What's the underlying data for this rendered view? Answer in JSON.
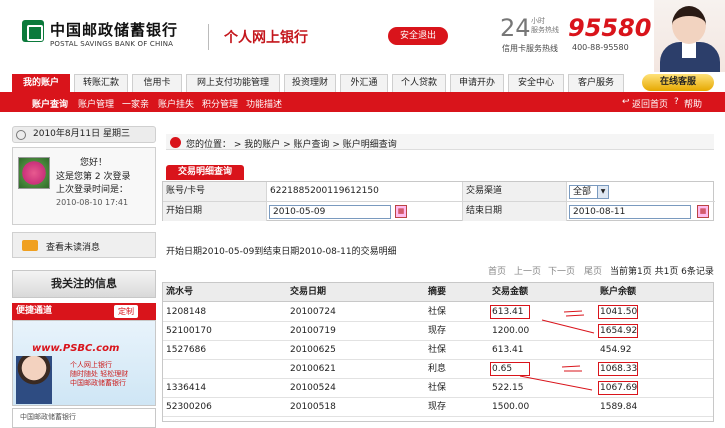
{
  "header": {
    "bank_cn": "中国邮政储蓄银行",
    "bank_en": "POSTAL SAVINGS BANK OF CHINA",
    "personal_bank": "个人网上银行",
    "logout_label": "安全退出",
    "hour24": "24",
    "service_small": "小时\n服务热线",
    "hotline": "95580",
    "card_hotline_label": "信用卡服务热线",
    "card_hotline": "400-88-95580"
  },
  "nav": {
    "tabs": [
      "我的账户",
      "转账汇款",
      "信用卡",
      "网上支付功能管理",
      "投资理财",
      "外汇通",
      "个人贷款",
      "申请开办",
      "安全中心",
      "客户服务"
    ],
    "online_service": "在线客服",
    "sub_items": [
      "账户查询",
      "账户管理",
      "一家亲",
      "账户挂失",
      "积分管理",
      "功能描述"
    ],
    "back_home": "返回首页",
    "help": "帮助"
  },
  "left": {
    "date": "2010年8月11日 星期三",
    "greeting": "您好！",
    "login_count_text": "这是您第 2 次登录",
    "last_login_label": "上次登录时间是：",
    "last_login_time": "2010-08-10 17:41",
    "unread_msgs": "查看未读消息",
    "focus_title": "我关注的信息",
    "quick_access": "便捷通道",
    "customize": "定制",
    "promo_brand": "www.PSBC.com",
    "promo_line1": "个人网上银行",
    "promo_line2": "随时随处 轻松理财",
    "promo_line3": "中国邮政储蓄银行",
    "promo2_text": "中国邮政储蓄银行"
  },
  "breadcrumb": {
    "text": "您的位置： > 我的账户 > 账户查询 > 账户明细查询"
  },
  "panel": {
    "tab": "交易明细查询"
  },
  "form": {
    "acct_label": "账号/卡号",
    "acct_value": "6221885200119612150",
    "channel_label": "交易渠道",
    "channel_value": "全部",
    "start_label": "开始日期",
    "start_value": "2010-05-09",
    "end_label": "结束日期",
    "end_value": "2010-08-11"
  },
  "summary": "开始日期2010-05-09到结束日期2010-08-11的交易明细",
  "pager": {
    "first": "首页",
    "prev": "上一页",
    "next": "下一页",
    "last": "尾页",
    "info": "当前第1页 共1页 6条记录"
  },
  "table": {
    "headers": [
      "流水号",
      "交易日期",
      "摘要",
      "交易金额",
      "账户余额"
    ],
    "rows": [
      [
        "1208148",
        "20100724",
        "社保",
        "613.41",
        "1041.50"
      ],
      [
        "52100170",
        "20100719",
        "现存",
        "1200.00",
        "1654.92"
      ],
      [
        "1527686",
        "20100625",
        "社保",
        "613.41",
        "454.92"
      ],
      [
        "",
        "20100621",
        "利息",
        "0.65",
        "1068.33"
      ],
      [
        "1336414",
        "20100524",
        "社保",
        "522.15",
        "1067.69"
      ],
      [
        "52300206",
        "20100518",
        "现存",
        "1500.00",
        "1589.84"
      ]
    ]
  },
  "colors": {
    "brand_red": "#d9141b",
    "brand_green": "#0b7a3b"
  }
}
